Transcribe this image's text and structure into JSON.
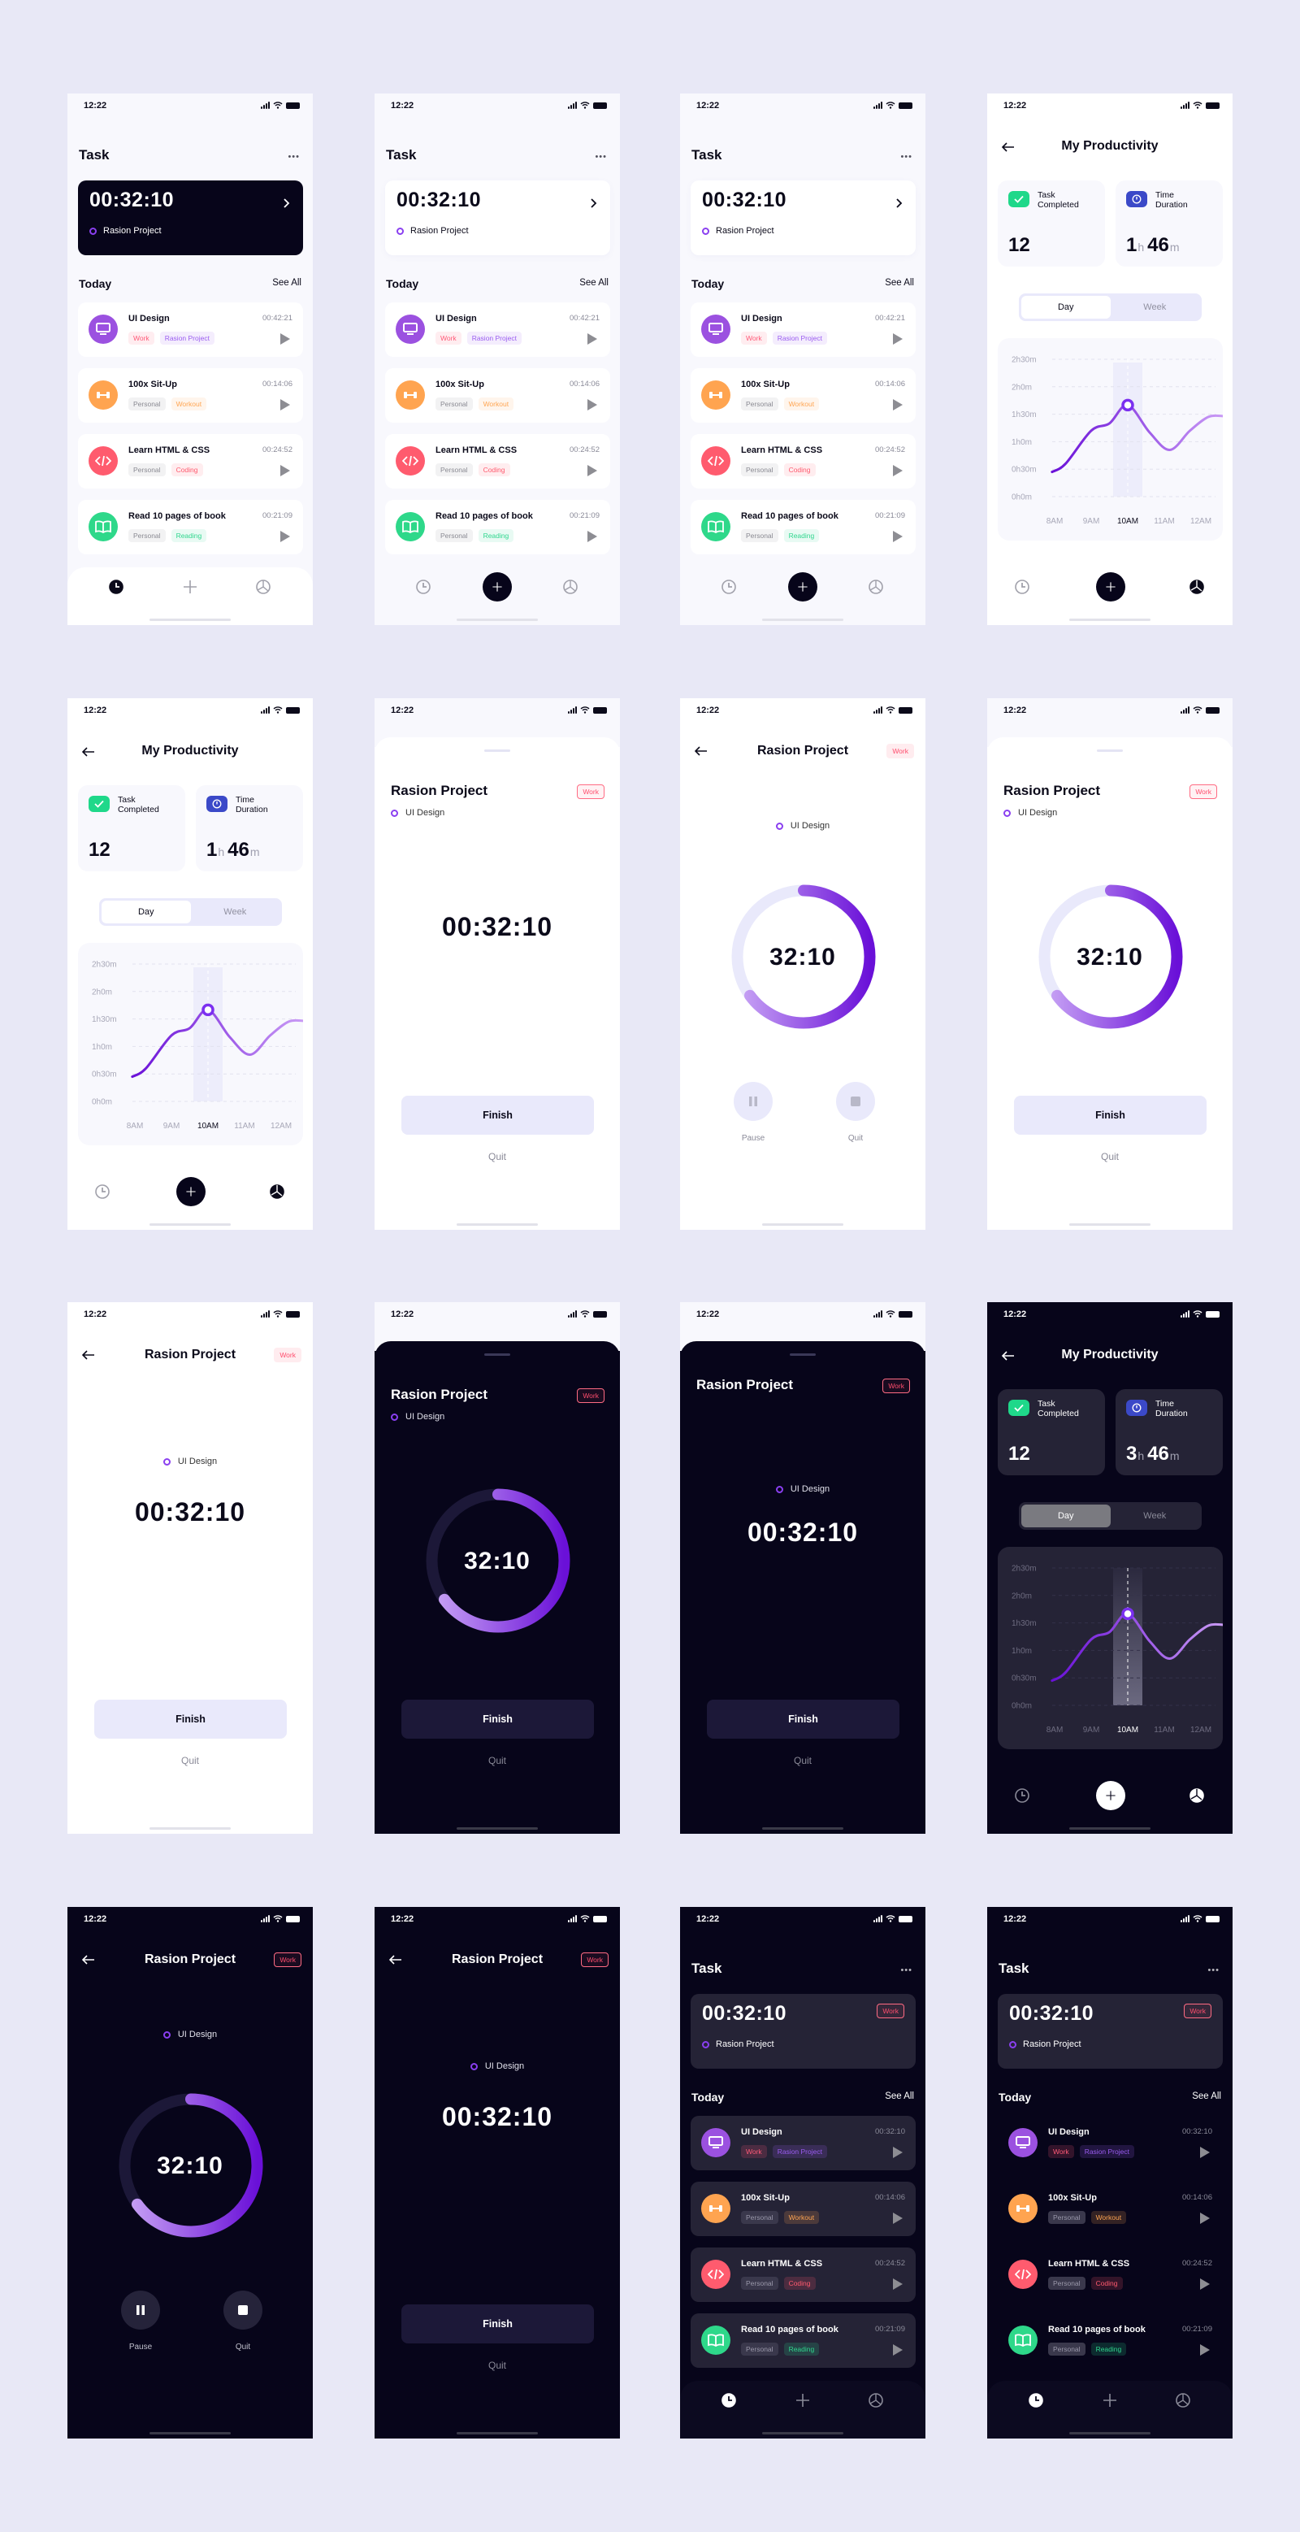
{
  "status": {
    "time": "12:22"
  },
  "task_screen": {
    "title": "Task",
    "more": "•••",
    "timer": "00:32:10",
    "project": "Rasion Project",
    "section": "Today",
    "see_all": "See All",
    "items": [
      {
        "name": "UI Design",
        "time": "00:42:21",
        "time_dark": "00:32:10",
        "icon": "monitor-icon",
        "color": "#9b51e0",
        "tags": [
          {
            "label": "Work",
            "color": "#ff5a78"
          },
          {
            "label": "Rasion Project",
            "color": "#9a5cf0"
          }
        ]
      },
      {
        "name": "100x Sit-Up",
        "time": "00:14:06",
        "time_dark": "00:14:06",
        "icon": "dumbbell-icon",
        "color": "#ffa450",
        "tags": [
          {
            "label": "Personal",
            "color": "#8a8a92"
          },
          {
            "label": "Workout",
            "color": "#ffa552"
          }
        ]
      },
      {
        "name": "Learn HTML & CSS",
        "time": "00:24:52",
        "time_dark": "00:24:52",
        "icon": "code-icon",
        "color": "#ff5b6e",
        "tags": [
          {
            "label": "Personal",
            "color": "#8a8a92"
          },
          {
            "label": "Coding",
            "color": "#ff5a6e"
          }
        ]
      },
      {
        "name": "Read 10 pages of book",
        "time": "00:21:09",
        "time_dark": "00:21:09",
        "icon": "book-icon",
        "color": "#2ed88a",
        "tags": [
          {
            "label": "Personal",
            "color": "#8a8a92"
          },
          {
            "label": "Reading",
            "color": "#2fd68e"
          }
        ]
      }
    ]
  },
  "productivity": {
    "title": "My Productivity",
    "task_completed_label": "Task Completed",
    "task_completed_value": "12",
    "time_duration_label": "Time Duration",
    "hour_unit": "h",
    "minute_unit": "m",
    "tabs": [
      "Day",
      "Week"
    ],
    "active_tab": "Day"
  },
  "timer_screen": {
    "project": "Rasion Project",
    "tag": "Work",
    "task": "UI Design",
    "timer_full": "00:32:10",
    "timer_short": "32:10",
    "ring_progress": 0.65,
    "finish": "Finish",
    "quit": "Quit",
    "pause": "Pause"
  },
  "colors": {
    "accent": "#7b2ff0",
    "accent_light": "#c9a6f5",
    "dark_bg": "#07051a",
    "dark_card": "#252336",
    "work_red": "#ff4d6d",
    "light_button": "#e9e9fb"
  },
  "chart_data": {
    "type": "line",
    "categories": [
      "8AM",
      "9AM",
      "10AM",
      "11AM",
      "12AM"
    ],
    "x_hours": [
      8,
      9,
      10,
      11,
      12
    ],
    "y_ticks": [
      "0h0m",
      "0h30m",
      "1h0m",
      "1h30m",
      "2h0m",
      "2h30m"
    ],
    "ylim_minutes": [
      0,
      150
    ],
    "grid": true,
    "highlight": "10AM",
    "series": [
      {
        "x": [
          7.93,
          8.3,
          9.0,
          9.5,
          10.0,
          10.6,
          11.15,
          11.7,
          12.2,
          12.6
        ],
        "y": [
          27,
          36,
          72,
          80,
          100,
          70,
          51,
          72,
          87,
          88
        ]
      }
    ]
  },
  "screens": [
    {
      "type": "task",
      "theme": "light",
      "card": "black",
      "nav": "plain"
    },
    {
      "type": "task",
      "theme": "light",
      "card": "white",
      "nav": "fab"
    },
    {
      "type": "task",
      "theme": "light",
      "card": "white",
      "nav": "fab"
    },
    {
      "type": "productivity",
      "theme": "light",
      "duration_h": "1",
      "duration_m": "46"
    },
    {
      "type": "productivity",
      "theme": "light",
      "duration_h": "1",
      "duration_m": "46"
    },
    {
      "type": "timer",
      "theme": "light",
      "layout": "sheet",
      "ring": false
    },
    {
      "type": "timer",
      "theme": "light",
      "layout": "back",
      "ring": true,
      "controls": "pause"
    },
    {
      "type": "timer",
      "theme": "light",
      "layout": "sheet",
      "ring": true
    },
    {
      "type": "timer",
      "theme": "light",
      "layout": "back",
      "ring": false
    },
    {
      "type": "timer",
      "theme": "dark",
      "layout": "sheet",
      "ring": true
    },
    {
      "type": "timer",
      "theme": "dark",
      "layout": "sheet-center",
      "ring": false
    },
    {
      "type": "productivity",
      "theme": "dark",
      "duration_h": "3",
      "duration_m": "46"
    },
    {
      "type": "timer",
      "theme": "dark",
      "layout": "back",
      "ring": true,
      "controls": "pause"
    },
    {
      "type": "timer",
      "theme": "dark",
      "layout": "back",
      "ring": false
    },
    {
      "type": "task",
      "theme": "dark",
      "card": "dark",
      "nav": "plain",
      "items": "card"
    },
    {
      "type": "task",
      "theme": "dark",
      "card": "dark",
      "nav": "plain",
      "items": "plain"
    }
  ]
}
